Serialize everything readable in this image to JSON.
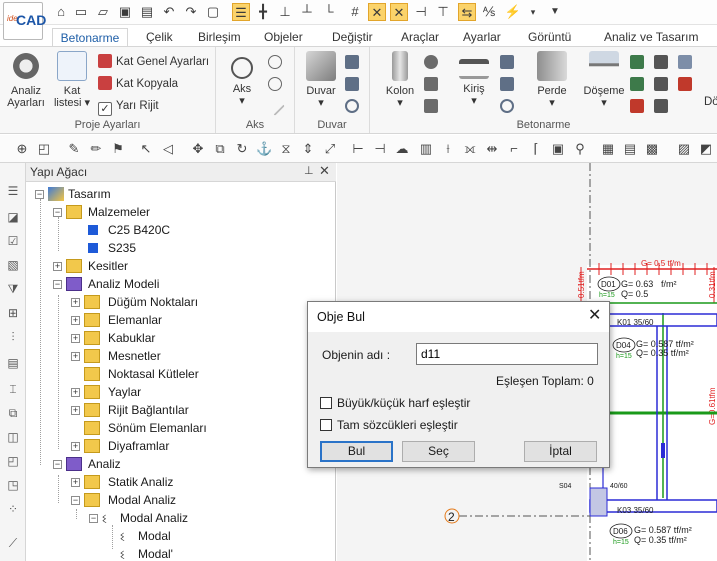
{
  "app": {
    "logo_small": "ide",
    "logo_big": "CAD"
  },
  "ribbon_tabs": [
    "Betonarme",
    "Çelik",
    "Birleşim",
    "Objeler",
    "Değiştir",
    "Araçlar",
    "Ayarlar",
    "Görüntü",
    "Analiz ve Tasarım"
  ],
  "ribbon": {
    "proje": {
      "group_label": "Proje Ayarları",
      "analiz_label1": "Analiz",
      "analiz_label2": "Ayarları",
      "kat_label1": "Kat",
      "kat_label2": "listesi",
      "kat_genel": "Kat Genel Ayarları",
      "kat_kopyala": "Kat Kopyala",
      "yari_rijit": "Yarı Rijit"
    },
    "aks": {
      "group_label": "Aks",
      "btn": "Aks"
    },
    "duvar": {
      "group_label": "Duvar",
      "btn": "Duvar"
    },
    "betonarme": {
      "group_label": "Betonarme",
      "kolon": "Kolon",
      "kiris": "Kiriş",
      "perde": "Perde",
      "doseme": "Döşeme",
      "do": "Dö"
    }
  },
  "tree": {
    "title": "Yapı Ağacı",
    "nodes": {
      "tasarim": "Tasarım",
      "malzemeler": "Malzemeler",
      "c25": "C25 B420C",
      "s235": "S235",
      "kesitler": "Kesitler",
      "analiz_modeli": "Analiz Modeli",
      "dugum": "Düğüm Noktaları",
      "elemanlar": "Elemanlar",
      "kabuklar": "Kabuklar",
      "mesnetler": "Mesnetler",
      "noktasal": "Noktasal Kütleler",
      "yaylar": "Yaylar",
      "rijit": "Rijit Bağlantılar",
      "sonum": "Sönüm Elemanları",
      "diyaframlar": "Diyaframlar",
      "analiz": "Analiz",
      "statik": "Statik Analiz",
      "modal_analiz": "Modal Analiz",
      "modal_analiz2": "Modal Analiz",
      "modal": "Modal",
      "modal2": "Modal'"
    }
  },
  "canvas": {
    "load_top": "G= 0.5 tf/m",
    "d01": "D01",
    "d01_g": "G= 0.63",
    "d01_q": "Q= 0.5",
    "d01_unit": "f/m²",
    "d01_h": "h=15",
    "k01": "K01 35/60",
    "d04": "D04",
    "d04_h": "h=15",
    "d04_g": "G= 0.587 tf/m²",
    "d04_q": "Q= 0.35 tf/m²",
    "s04": "S04",
    "s_4060": "40/60",
    "k03": "K03 35/60",
    "d06": "D06",
    "d06_h": "h=15",
    "d06_g": "G= 0.587 tf/m²",
    "d06_q": "Q= 0.35 tf/m²",
    "axis2": "2",
    "vert_load": "0.51tfm",
    "vert_load_r": "G=0.61tfm",
    "vert_load_r2": "0.31tfm"
  },
  "dialog": {
    "title": "Obje Bul",
    "name_label": "Objenin adı :",
    "name_value": "d11",
    "match_total": "Eşleşen Toplam: 0",
    "chk_case": "Büyük/küçük harf eşleştir",
    "chk_whole": "Tam sözcükleri eşleştir",
    "btn_find": "Bul",
    "btn_select": "Seç",
    "btn_cancel": "İptal"
  },
  "colors": {
    "accent": "#1f5fa8",
    "highlight": "#fbd36a",
    "load_red": "#e02020",
    "beam_blue": "#2b2bd6",
    "axis_green": "#1a9a1a"
  }
}
